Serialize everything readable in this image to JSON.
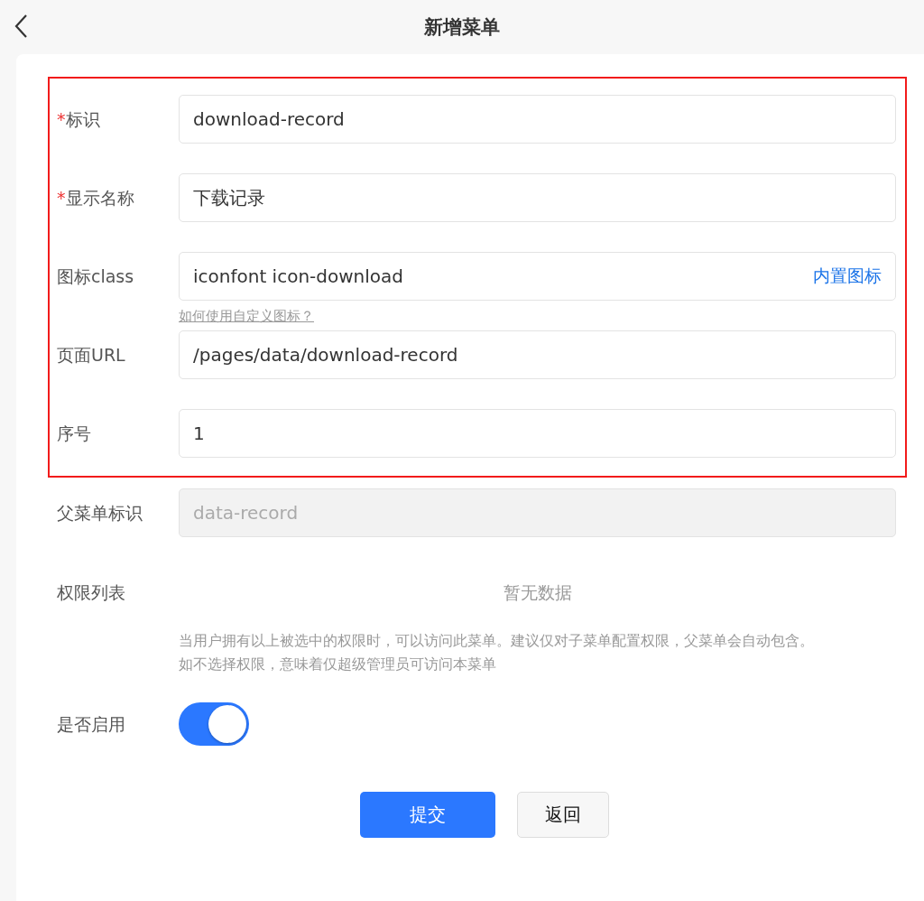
{
  "header": {
    "title": "新增菜单"
  },
  "required_mark": "*",
  "highlighted_fields": [
    {
      "label": "标识",
      "required": true,
      "value": "download-record"
    },
    {
      "label": "显示名称",
      "required": true,
      "value": "下载记录"
    },
    {
      "label": "图标class",
      "required": false,
      "value": "iconfont icon-download",
      "suffix_link": "内置图标",
      "hint_link": "如何使用自定义图标？"
    },
    {
      "label": "页面URL",
      "required": false,
      "value": "/pages/data/download-record"
    },
    {
      "label": "序号",
      "required": false,
      "value": "1"
    }
  ],
  "parent_field": {
    "label": "父菜单标识",
    "placeholder": "data-record",
    "disabled": true
  },
  "permissions": {
    "label": "权限列表",
    "empty_text": "暂无数据",
    "help_lines": [
      "当用户拥有以上被选中的权限时，可以访问此菜单。建议仅对子菜单配置权限，父菜单会自动包含。",
      "如不选择权限，意味着仅超级管理员可访问本菜单"
    ]
  },
  "enable": {
    "label": "是否启用",
    "on": true
  },
  "buttons": [
    {
      "label": "提交",
      "kind": "primary"
    },
    {
      "label": "返回",
      "kind": "secondary"
    }
  ]
}
